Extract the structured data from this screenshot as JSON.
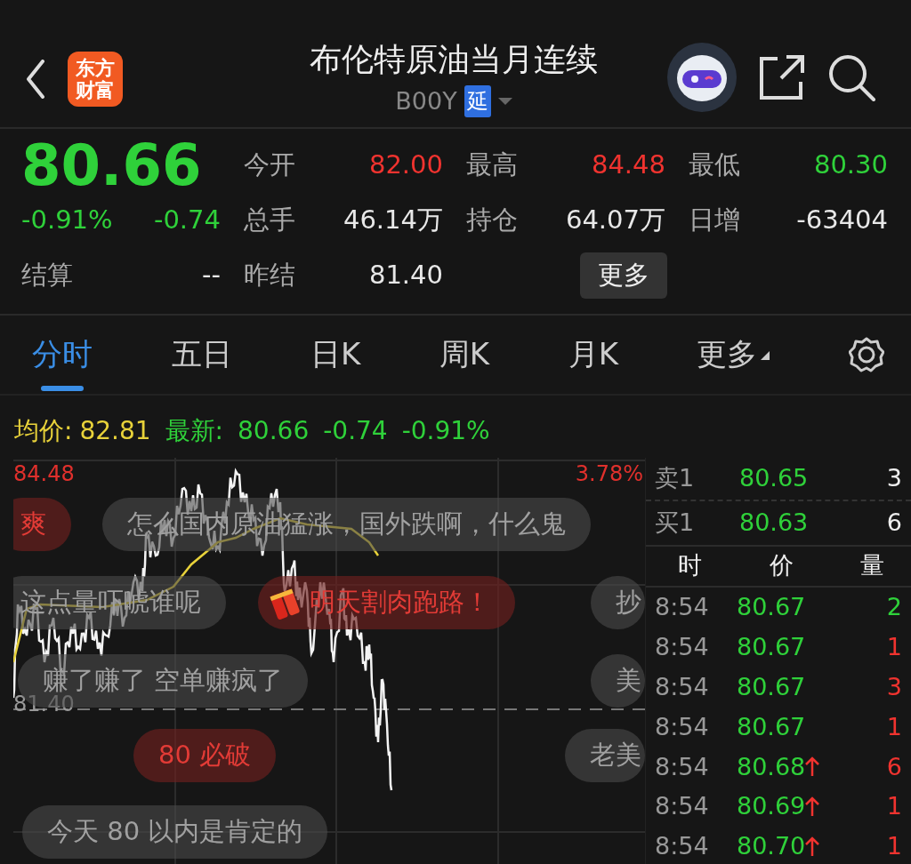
{
  "header": {
    "logo_text": "东方财富",
    "title": "布伦特原油当月连续",
    "code": "B00Y",
    "tag": "延"
  },
  "quote": {
    "price": "80.66",
    "change_pct": "-0.91%",
    "change": "-0.74",
    "color": "#2fd13a",
    "settle_label": "结算",
    "settle_value": "--",
    "stats": [
      {
        "label": "今开",
        "value": "82.00",
        "color": "#f0332f"
      },
      {
        "label": "最高",
        "value": "84.48",
        "color": "#f0332f"
      },
      {
        "label": "最低",
        "value": "80.30",
        "color": "#2fd13a"
      },
      {
        "label": "总手",
        "value": "46.14万",
        "color": "#e8e8e8"
      },
      {
        "label": "持仓",
        "value": "64.07万",
        "color": "#e8e8e8"
      },
      {
        "label": "日增",
        "value": "-63404",
        "color": "#e8e8e8"
      },
      {
        "label": "昨结",
        "value": "81.40",
        "color": "#e8e8e8"
      }
    ],
    "more_button": "更多"
  },
  "tabs": [
    {
      "label": "分时",
      "selected": true
    },
    {
      "label": "五日",
      "selected": false
    },
    {
      "label": "日K",
      "selected": false
    },
    {
      "label": "周K",
      "selected": false
    },
    {
      "label": "月K",
      "selected": false
    },
    {
      "label": "更多",
      "selected": false,
      "dropdown": true
    }
  ],
  "info_line": {
    "avg_label": "均价:",
    "avg_value": "82.81",
    "latest_label": "最新:",
    "latest_value": "80.66",
    "change": "-0.74",
    "change_pct": "-0.91%"
  },
  "chart": {
    "top_price": "84.48",
    "top_pct": "3.78%",
    "ref_price": "81.40"
  },
  "comments": [
    {
      "text": "爽",
      "kind": "hot"
    },
    {
      "text": "怎么国内原油猛涨，国外跌啊，什么鬼",
      "kind": "normal"
    },
    {
      "text": "这点量吓唬谁呢",
      "kind": "normal"
    },
    {
      "text": "明天割肉跑路！",
      "kind": "hot",
      "firecracker": true
    },
    {
      "text": "抄",
      "kind": "normal"
    },
    {
      "text": "赚了赚了  空单赚疯了",
      "kind": "normal"
    },
    {
      "text": "美",
      "kind": "normal"
    },
    {
      "text": "80 必破",
      "kind": "hot"
    },
    {
      "text": "老美",
      "kind": "normal"
    },
    {
      "text": "今天 80 以内是肯定的",
      "kind": "normal"
    }
  ],
  "order_book": [
    {
      "label": "卖1",
      "price": "80.65",
      "volume": "3"
    },
    {
      "label": "买1",
      "price": "80.63",
      "volume": "6"
    }
  ],
  "trades_header": [
    "时",
    "价",
    "量"
  ],
  "trades": [
    {
      "time": "8:54",
      "price": "80.67",
      "up": false,
      "volume": "2",
      "color": "#2fd13a"
    },
    {
      "time": "8:54",
      "price": "80.67",
      "up": false,
      "volume": "1",
      "color": "#f0332f"
    },
    {
      "time": "8:54",
      "price": "80.67",
      "up": false,
      "volume": "3",
      "color": "#f0332f"
    },
    {
      "time": "8:54",
      "price": "80.67",
      "up": false,
      "volume": "1",
      "color": "#f0332f"
    },
    {
      "time": "8:54",
      "price": "80.68",
      "up": true,
      "volume": "6",
      "color": "#f0332f"
    },
    {
      "time": "8:54",
      "price": "80.69",
      "up": true,
      "volume": "1",
      "color": "#f0332f"
    },
    {
      "time": "8:54",
      "price": "80.70",
      "up": true,
      "volume": "1",
      "color": "#f0332f"
    }
  ]
}
